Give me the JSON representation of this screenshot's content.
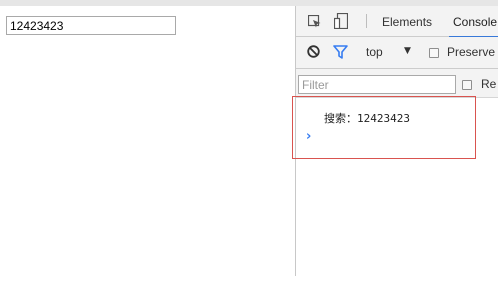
{
  "page": {
    "search_value": "12423423"
  },
  "devtools": {
    "tabs": {
      "elements": "Elements",
      "console": "Console"
    },
    "toolbar": {
      "context": "top",
      "preserve_log": "Preserve"
    },
    "filter": {
      "placeholder": "Filter",
      "regex_label": "Re"
    },
    "console": {
      "log_text": "搜索：12423423",
      "prompt": "›"
    },
    "colors": {
      "accent": "#367cf1",
      "highlight": "#d9534f"
    },
    "icons": [
      "inspect-icon",
      "device-toolbar-icon",
      "clear-console-icon",
      "filter-icon",
      "dropdown-caret-icon",
      "prompt-icon"
    ]
  }
}
